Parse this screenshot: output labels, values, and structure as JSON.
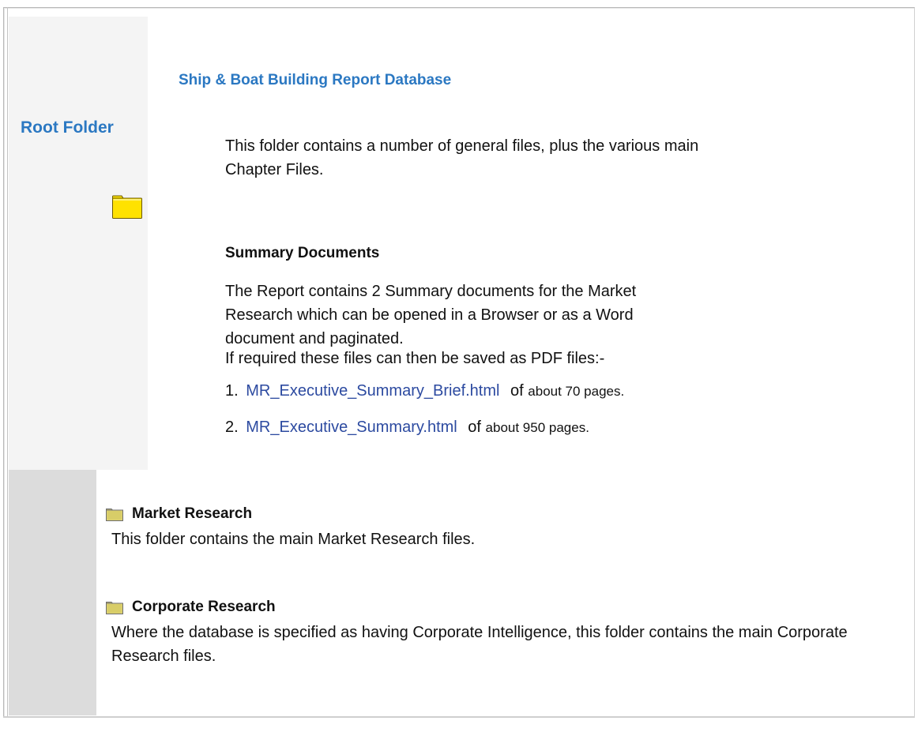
{
  "sidebar": {
    "root_label": "Root Folder",
    "root_icon": "folder-icon"
  },
  "main": {
    "title": "Ship & Boat Building Report Database",
    "intro": "This folder contains a number of general files, plus the various main Chapter Files.",
    "summary": {
      "heading": "Summary Documents",
      "description": "The Report contains 2 Summary documents for the Market Research which can be opened in a Browser or as a Word document and paginated.",
      "pdf_note": "If required these files can then be saved as PDF files:-",
      "documents": [
        {
          "number": "1.",
          "link": "MR_Executive_Summary_Brief.html",
          "of": "of",
          "pages": "about 70 pages."
        },
        {
          "number": "2.",
          "link": "MR_Executive_Summary.html",
          "of": "of",
          "pages": "about 950 pages."
        }
      ]
    }
  },
  "folders": [
    {
      "icon": "folder-icon",
      "title": "Market Research",
      "description": "This folder contains the main Market Research files."
    },
    {
      "icon": "folder-icon",
      "title": "Corporate Research",
      "description": "Where the database is specified as having Corporate Intelligence, this folder contains the main Corporate Research files."
    }
  ],
  "colors": {
    "title_blue": "#2b78c2",
    "link_blue": "#2c4aa0",
    "sidebar_light": "#f4f4f4",
    "sidebar_dark": "#dcdcdc",
    "folder_yellow": "#ffe200"
  }
}
